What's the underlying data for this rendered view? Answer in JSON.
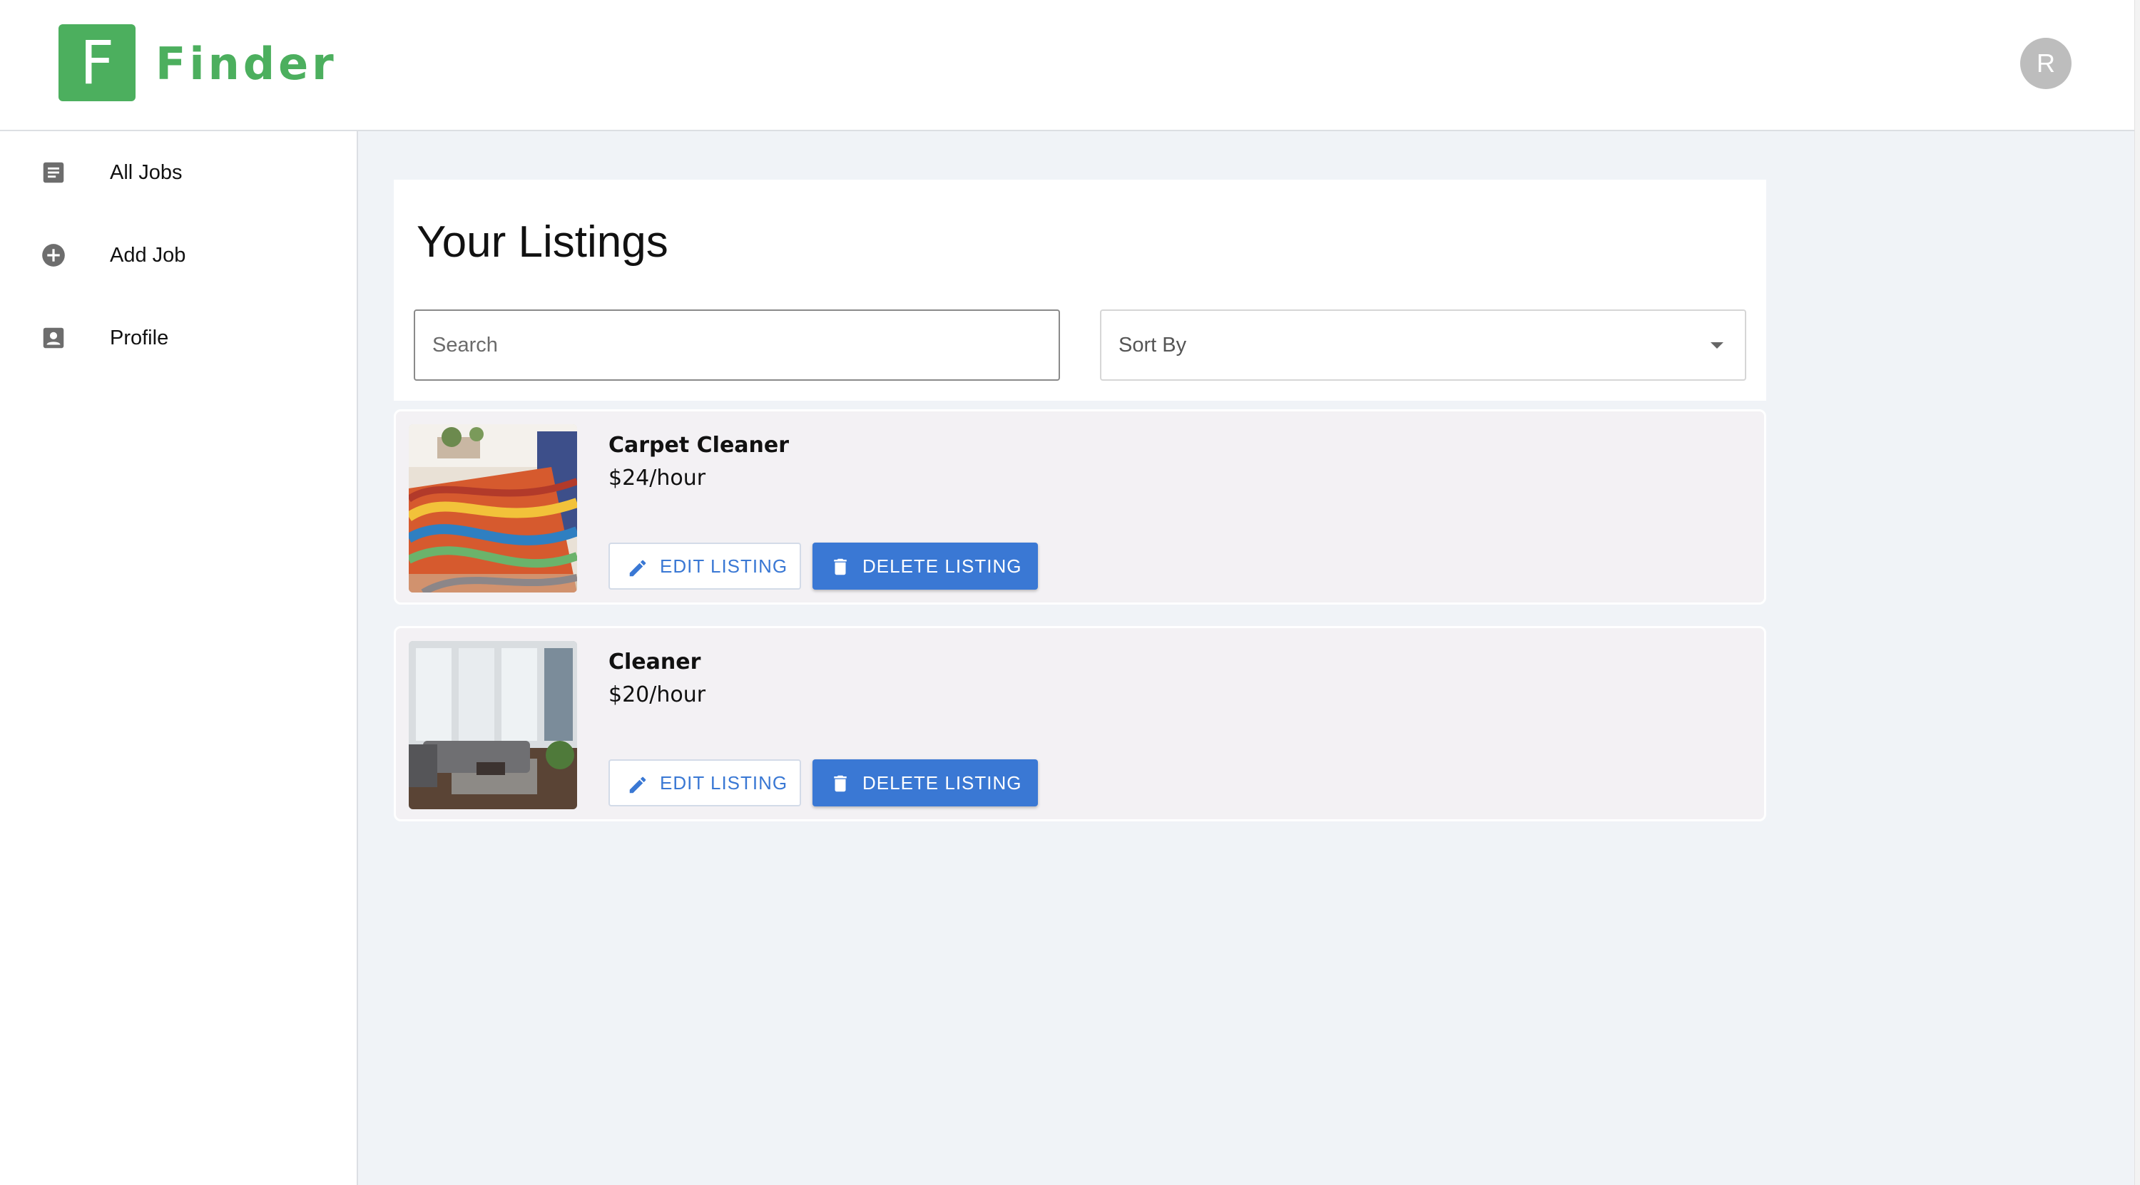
{
  "app": {
    "logo_letter": "F",
    "name": "Finder",
    "brand_color": "#4caf5e",
    "accent_color": "#3a78d4",
    "avatar_initial": "R"
  },
  "sidebar": {
    "items": [
      {
        "label": "All Jobs",
        "icon": "list-document-icon"
      },
      {
        "label": "Add Job",
        "icon": "add-circle-icon"
      },
      {
        "label": "Profile",
        "icon": "profile-badge-icon"
      }
    ]
  },
  "main": {
    "title": "Your Listings",
    "search": {
      "placeholder": "Search",
      "value": ""
    },
    "sort": {
      "label": "Sort By"
    }
  },
  "listings": [
    {
      "title": "Carpet Cleaner",
      "price": "$24/hour",
      "image": "colorful-swirl-rug-photo",
      "edit_label": "EDIT LISTING",
      "delete_label": "DELETE LISTING"
    },
    {
      "title": "Cleaner",
      "price": "$20/hour",
      "image": "modern-living-room-photo",
      "edit_label": "EDIT LISTING",
      "delete_label": "DELETE LISTING"
    }
  ]
}
